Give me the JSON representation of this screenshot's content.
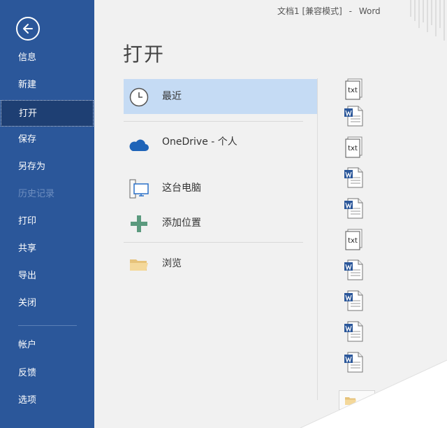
{
  "window": {
    "title": "文档1 [兼容模式]",
    "separator": "-",
    "app": "Word"
  },
  "page_title": "打开",
  "sidebar": {
    "items": [
      {
        "label": "信息",
        "state": "normal"
      },
      {
        "label": "新建",
        "state": "normal"
      },
      {
        "label": "打开",
        "state": "active"
      },
      {
        "label": "保存",
        "state": "normal"
      },
      {
        "label": "另存为",
        "state": "normal"
      },
      {
        "label": "历史记录",
        "state": "disabled"
      },
      {
        "label": "打印",
        "state": "normal"
      },
      {
        "label": "共享",
        "state": "normal"
      },
      {
        "label": "导出",
        "state": "normal"
      },
      {
        "label": "关闭",
        "state": "normal"
      },
      {
        "label": "帐户",
        "state": "normal"
      },
      {
        "label": "反馈",
        "state": "normal"
      },
      {
        "label": "选项",
        "state": "normal"
      }
    ]
  },
  "places": [
    {
      "label": "最近",
      "icon": "clock-icon",
      "selected": true
    },
    {
      "label": "OneDrive - 个人",
      "icon": "cloud-icon",
      "selected": false
    },
    {
      "label": "这台电脑",
      "icon": "computer-icon",
      "selected": false
    },
    {
      "label": "添加位置",
      "icon": "plus-icon",
      "selected": false
    },
    {
      "label": "浏览",
      "icon": "folder-icon",
      "selected": false
    }
  ],
  "recent_files": [
    {
      "type": "txt",
      "label": "txt"
    },
    {
      "type": "word"
    },
    {
      "type": "txt",
      "label": "txt"
    },
    {
      "type": "word"
    },
    {
      "type": "word"
    },
    {
      "type": "txt",
      "label": "txt"
    },
    {
      "type": "word"
    },
    {
      "type": "word"
    },
    {
      "type": "word"
    },
    {
      "type": "word"
    }
  ],
  "colors": {
    "sidebar": "#2b579a",
    "sidebar_active": "#1e3f73",
    "selected_place": "#c5dbf4",
    "word_blue": "#2b579a"
  }
}
